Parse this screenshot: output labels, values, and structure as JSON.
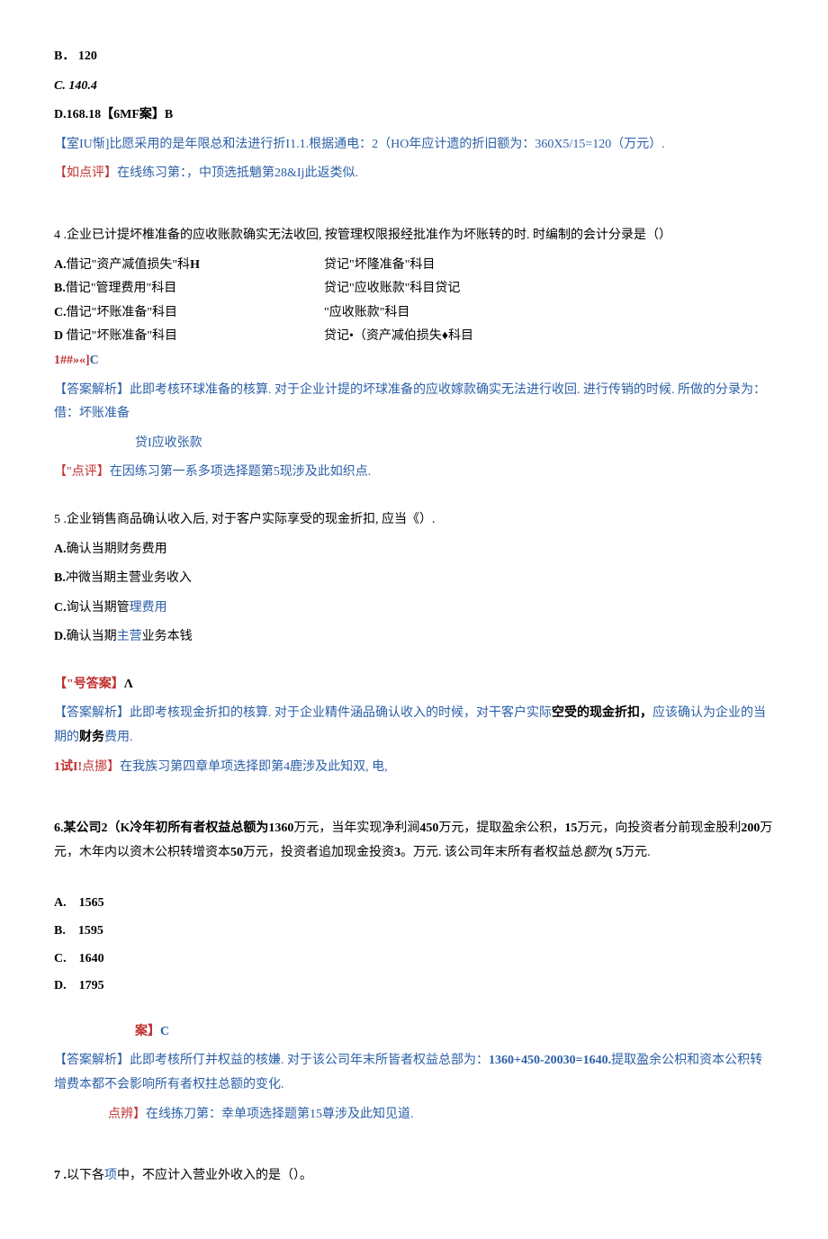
{
  "q3": {
    "optB": "B． 120",
    "optC": "C. 140.4",
    "optD_and_ans": "D.168.18【6MF案】B",
    "analysis_label": "【室IU惭]",
    "analysis_text": "比愿采用的是年限总和法进行折I1.1.根据通电：2（HO年应计遗的折旧额为：360X5/15=120（万元）.",
    "comment_label": "【如点评】",
    "comment_text": "在线练习第：，中顶选抵魈第28&Ij此返类似."
  },
  "q4": {
    "stem": "4 .企业已计提坏椎准备的应收账款确实无法收回, 按管理权限报经批准作为坏账转的时. 时编制的会计分录是（）",
    "rowA_l": "A.借记\"资产减值损失\"科H",
    "rowA_r": "贷记\"坏隆准备\"科目",
    "rowB_l": "B.借记\"管理费用\"科目",
    "rowB_r": "贷记\"应收账款\"科目贷记",
    "rowC_l": "C.借记\"坏账准备\"科目",
    "rowC_r": "\"应收账款\"科目",
    "rowD_l": "D 借记\"坏账准备\"科目",
    "rowD_r": "贷记•（资产减伯损失♦科目",
    "ans_code": "1##»«]",
    "ans_letter": "C",
    "analysis_label": "【答案解析】",
    "analysis_text": "此即考核环球准备的核算. 对于企业计提的坏球准备的应收嫁款确实无法进行收回. 进行传销的时候. 所做的分录为：借：坏账准备",
    "analysis_text2": "贷I应收张款",
    "comment_label": "【\"点评】",
    "comment_text": "在因练习第一系多项选择题第5现涉及此如织点."
  },
  "q5": {
    "stem": "5 .企业销售商品确认收入后, 对于客户实际享受的现金折扣, 应当《）.",
    "optA": "A.确认当期财务费用",
    "optB": "B.冲微当期主营业务收入",
    "optC": "C.询认当期管理费用",
    "optD": "D.确认当期主营业务本钱",
    "ans_label": "【\"号答案】",
    "ans_letter": "Λ",
    "analysis_label": "【答案解析】",
    "analysis_text_1": "此即考核现金折扣的核算. 对于企业精件涵品确认收入的时候，对干客户实际",
    "analysis_text_bold": "空受的现金折扣，",
    "analysis_text_2": "应该确认为企业的当期的",
    "analysis_text_bold2": "财务",
    "analysis_text_3": "费用.",
    "comment_pre_bold": "1试I!",
    "comment_label": "点挪】",
    "comment_text": "在我族习第四章单项选择即第4鹿涉及此知双, 电,"
  },
  "q6": {
    "stem_1": "6.某公司2（K冷年初所有者权益总额为",
    "stem_b1": "1360",
    "stem_2": "万元，当年实现净利涧",
    "stem_b2": "450",
    "stem_3": "万元，提取盈余公积，",
    "stem_b3": "15",
    "stem_4": "万元，向投资者分前现金股利",
    "stem_b4": "200",
    "stem_5": "万元，木年内以资木公枳转增资本",
    "stem_b5": "50",
    "stem_6": "万元，投资者追加现金投资",
    "stem_b6": "3",
    "stem_7": "。万元. 该公司年末所有者权益总",
    "stem_i": "额为",
    "stem_b7": "( 5",
    "stem_8": "万元.",
    "optA": "A.　1565",
    "optB": "B.　1595",
    "optC": "C.　1640",
    "optD": "D.　1795",
    "ans_label": "案】",
    "ans_letter": "C",
    "analysis_label": "【答案解析】",
    "analysis_text_1": "此即考核所仃并权益的核嫌. 对于该公司年末所皆者权益总部为：",
    "analysis_text_bold": "1360+450-20030=1640.",
    "analysis_text_2": "提取盈余公枳和资本公积转增费本都不会影响所有者权拄总额的变化.",
    "comment_label": "点辨】",
    "comment_text": "在线拣刀第：幸单项选择题第15尊涉及此知见道."
  },
  "q7": {
    "stem": "7 .以下各项中，不应计入营业外收入的是（）。"
  }
}
